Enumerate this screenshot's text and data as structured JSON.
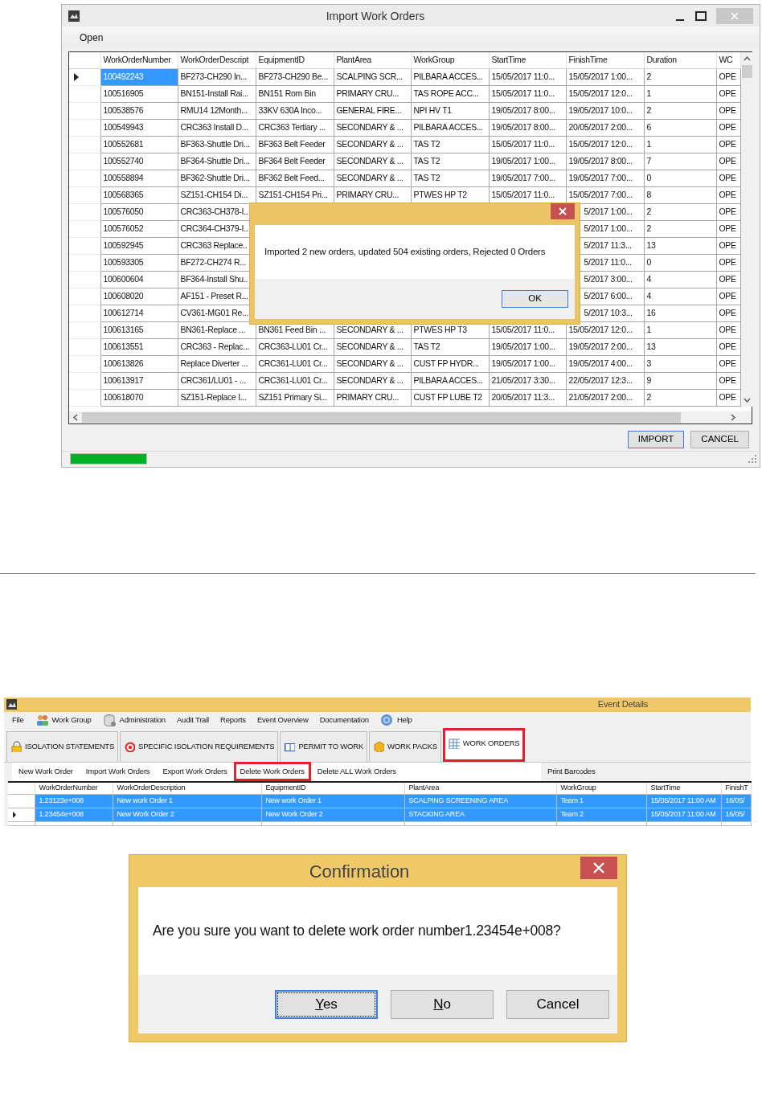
{
  "import_window": {
    "title": "Import Work Orders",
    "menu": [
      "Open"
    ],
    "grid": {
      "columns": [
        "WorkOrderNumber",
        "WorkOrderDescript",
        "EquipmentID",
        "PlantArea",
        "WorkGroup",
        "StartTime",
        "FinishTime",
        "Duration",
        "WC"
      ],
      "rows": [
        {
          "current": true,
          "selected": true,
          "cells": [
            "100492243",
            "BF273-CH290 In...",
            "BF273-CH290 Be...",
            "SCALPING SCR...",
            "PILBARA ACCES...",
            "15/05/2017 11:0...",
            "15/05/2017 1:00...",
            "2",
            "OPE"
          ]
        },
        {
          "current": false,
          "selected": false,
          "cells": [
            "100516905",
            "BN151-Install Rai...",
            "BN151 Rom Bin",
            "PRIMARY CRU...",
            "TAS ROPE ACC...",
            "15/05/2017 11:0...",
            "15/05/2017 12:0...",
            "1",
            "OPE"
          ]
        },
        {
          "current": false,
          "selected": false,
          "cells": [
            "100538576",
            "RMU14 12Month...",
            "33KV 630A Inco...",
            "GENERAL FIRE...",
            "NPI HV T1",
            "19/05/2017 8:00...",
            "19/05/2017 10:0...",
            "2",
            "OPE"
          ]
        },
        {
          "current": false,
          "selected": false,
          "cells": [
            "100549943",
            "CRC363 Install D...",
            "CRC363 Tertiary ...",
            "SECONDARY & ...",
            "PILBARA ACCES...",
            "19/05/2017 8:00...",
            "20/05/2017 2:00...",
            "6",
            "OPE"
          ]
        },
        {
          "current": false,
          "selected": false,
          "cells": [
            "100552681",
            "BF363-Shuttle Dri...",
            "BF363 Belt Feeder",
            "SECONDARY & ...",
            "TAS T2",
            "15/05/2017 11:0...",
            "15/05/2017 12:0...",
            "1",
            "OPE"
          ]
        },
        {
          "current": false,
          "selected": false,
          "cells": [
            "100552740",
            "BF364-Shuttle Dri...",
            "BF364 Belt Feeder",
            "SECONDARY & ...",
            "TAS T2",
            "19/05/2017 1:00...",
            "19/05/2017 8:00...",
            "7",
            "OPE"
          ]
        },
        {
          "current": false,
          "selected": false,
          "cells": [
            "100558894",
            "BF362-Shuttle Dri...",
            "BF362 Belt Feed...",
            "SECONDARY & ...",
            "TAS T2",
            "19/05/2017 7:00...",
            "19/05/2017 7:00...",
            "0",
            "OPE"
          ]
        },
        {
          "current": false,
          "selected": false,
          "cells": [
            "100568365",
            "SZ151-CH154 Di...",
            "SZ151-CH154 Pri...",
            "PRIMARY CRU...",
            "PTWES HP T2",
            "15/05/2017 11:0...",
            "15/05/2017 7:00...",
            "8",
            "OPE"
          ]
        },
        {
          "current": false,
          "selected": false,
          "covered": true,
          "cells": [
            "100576050",
            "CRC363-CH378-I..",
            "5/2017 1:00...",
            "2",
            "OPE"
          ]
        },
        {
          "current": false,
          "selected": false,
          "covered": true,
          "cells": [
            "100576052",
            "CRC364-CH379-I..",
            "5/2017 1:00...",
            "2",
            "OPE"
          ]
        },
        {
          "current": false,
          "selected": false,
          "covered": true,
          "cells": [
            "100592945",
            "CRC363 Replace..",
            "5/2017 11:3...",
            "13",
            "OPE"
          ]
        },
        {
          "current": false,
          "selected": false,
          "covered": true,
          "cells": [
            "100593305",
            "BF272-CH274 R...",
            "5/2017 11:0...",
            "0",
            "OPE"
          ]
        },
        {
          "current": false,
          "selected": false,
          "covered": true,
          "cells": [
            "100600604",
            "BF364-Install Shu..",
            "5/2017 3:00...",
            "4",
            "OPE"
          ]
        },
        {
          "current": false,
          "selected": false,
          "covered": true,
          "cells": [
            "100608020",
            "AF151 - Preset R...",
            "5/2017 6:00...",
            "4",
            "OPE"
          ]
        },
        {
          "current": false,
          "selected": false,
          "covered": true,
          "cells": [
            "100612714",
            "CV361-MG01 Re...",
            "5/2017 10:3...",
            "16",
            "OPE"
          ]
        },
        {
          "current": false,
          "selected": false,
          "cells": [
            "100613165",
            "BN361-Replace ...",
            "BN361 Feed Bin ...",
            "SECONDARY & ...",
            "PTWES HP T3",
            "15/05/2017 11:0...",
            "15/05/2017 12:0...",
            "1",
            "OPE"
          ]
        },
        {
          "current": false,
          "selected": false,
          "cells": [
            "100613551",
            "CRC363 - Replac...",
            "CRC363-LU01 Cr...",
            "SECONDARY & ...",
            "TAS T2",
            "19/05/2017 1:00...",
            "19/05/2017 2:00...",
            "13",
            "OPE"
          ]
        },
        {
          "current": false,
          "selected": false,
          "cells": [
            "100613826",
            "Replace Diverter ...",
            "CRC361-LU01 Cr...",
            "SECONDARY & ...",
            "CUST FP HYDR...",
            "19/05/2017 1:00...",
            "19/05/2017 4:00...",
            "3",
            "OPE"
          ]
        },
        {
          "current": false,
          "selected": false,
          "cells": [
            "100613917",
            "CRC361/LU01 - ...",
            "CRC361-LU01 Cr...",
            "SECONDARY & ...",
            "PILBARA ACCES...",
            "21/05/2017 3:30...",
            "22/05/2017 12:3...",
            "9",
            "OPE"
          ]
        },
        {
          "current": false,
          "selected": false,
          "cells": [
            "100618070",
            "SZ151-Replace I...",
            "SZ151 Primary Si...",
            "PRIMARY CRU...",
            "CUST FP LUBE T2",
            "20/05/2017 11:3...",
            "21/05/2017 2:00...",
            "2",
            "OPE"
          ]
        }
      ]
    },
    "message_dialog": {
      "message": "Imported 2 new orders,  updated 504 existing orders, Rejected 0 Orders",
      "button": "OK"
    },
    "buttons": [
      {
        "label": "IMPORT",
        "default": true
      },
      {
        "label": "CANCEL",
        "default": false
      }
    ],
    "progress": {
      "level": 1
    }
  },
  "event_window": {
    "title": "Event Details",
    "menu": [
      {
        "label": "File",
        "kind": "plain"
      },
      {
        "label": "Work Group",
        "kind": "people"
      },
      {
        "label": "Administration",
        "kind": "database"
      },
      {
        "label": "Audit Trail",
        "kind": "plain"
      },
      {
        "label": "Reports",
        "kind": "plain"
      },
      {
        "label": "Event Overview",
        "kind": "plain"
      },
      {
        "label": "Documentation",
        "kind": "plain"
      },
      {
        "label": "Help",
        "kind": "help"
      }
    ],
    "tabs": [
      {
        "label": "ISOLATION STATEMENTS",
        "kind": "lock",
        "selected": false,
        "highlighted": false
      },
      {
        "label": "SPECIFIC ISOLATION REQUIREMENTS",
        "kind": "target",
        "selected": false,
        "highlighted": false
      },
      {
        "label": "PERMIT TO WORK",
        "kind": "book",
        "selected": false,
        "highlighted": false
      },
      {
        "label": "WORK PACKS",
        "kind": "pack",
        "selected": false,
        "highlighted": false
      },
      {
        "label": "WORK ORDERS",
        "kind": "table",
        "selected": true,
        "highlighted": true
      }
    ],
    "toolbar": [
      {
        "label": "New Work Order",
        "highlighted": false
      },
      {
        "label": "Import Work Orders",
        "highlighted": false
      },
      {
        "label": "Export Work Orders",
        "highlighted": false
      },
      {
        "label": "Delete Work Orders",
        "highlighted": true
      },
      {
        "label": "Delete ALL Work Orders",
        "highlighted": false
      }
    ],
    "print_button": "Print Barcodes",
    "grid": {
      "columns": [
        "WorkOrderNumber",
        "WorkOrderDescription",
        "EquipmentID",
        "PlantArea",
        "WorkGroup",
        "StartTime",
        "FinishT"
      ],
      "rows": [
        {
          "current": false,
          "selected": true,
          "cells": [
            "1.23123e+008",
            "New work Order 1",
            "New work Order 1",
            "SCALPING SCREENING AREA",
            "Team 1",
            "15/05/2017 11:00 AM",
            "16/05/"
          ]
        },
        {
          "current": true,
          "selected": true,
          "cells": [
            "1.23454e+008",
            "New Work Order 2",
            "New Work Order 2",
            "STACKING AREA",
            "Team 2",
            "15/05/2017 11:00 AM",
            "16/05/"
          ]
        }
      ]
    }
  },
  "confirmation": {
    "title": "Confirmation",
    "message": "Are you sure you want to delete work order number1.23454e+008?",
    "buttons": [
      {
        "label": "Yes",
        "mnemonic": true,
        "focused": true
      },
      {
        "label": "No",
        "mnemonic": true,
        "focused": false
      },
      {
        "label": "Cancel",
        "mnemonic": false,
        "focused": false
      }
    ]
  }
}
